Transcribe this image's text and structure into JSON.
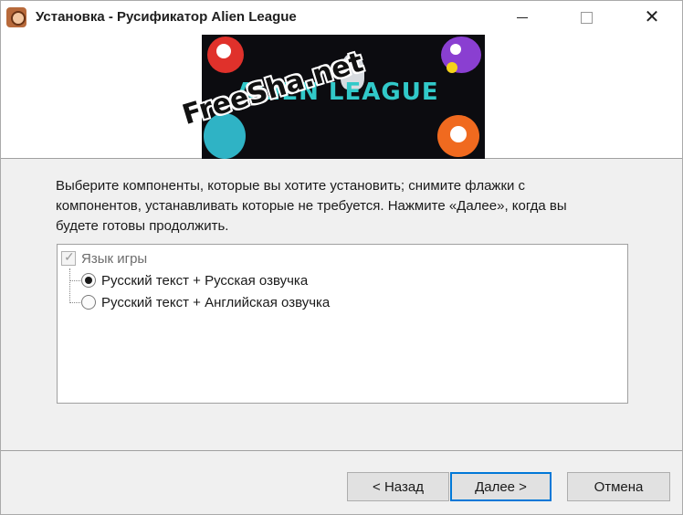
{
  "window": {
    "title": "Установка - Русификатор Alien League"
  },
  "banner": {
    "game_logo_text": "ALIEN LEAGUE",
    "watermark": "FreeSha.net"
  },
  "instructions": {
    "line1": "Выберите компоненты, которые вы хотите установить; снимите флажки с",
    "line2": "компонентов, устанавливать которые не требуется. Нажмите «Далее», когда вы",
    "line3": "будете готовы продолжить."
  },
  "components": {
    "parent": {
      "label": "Язык игры",
      "checked": true,
      "disabled": true
    },
    "options": [
      {
        "label": "Русский текст + Русская озвучка",
        "selected": true
      },
      {
        "label": "Русский текст + Английская озвучка",
        "selected": false
      }
    ]
  },
  "buttons": {
    "back": "< Назад",
    "next": "Далее >",
    "cancel": "Отмена"
  },
  "icons": {
    "app": "installer-app-icon",
    "minimize": "minimize-icon",
    "maximize": "maximize-icon",
    "close": "close-icon"
  },
  "colors": {
    "default_button_border": "#0078d7",
    "banner_text": "#31c9c9"
  }
}
